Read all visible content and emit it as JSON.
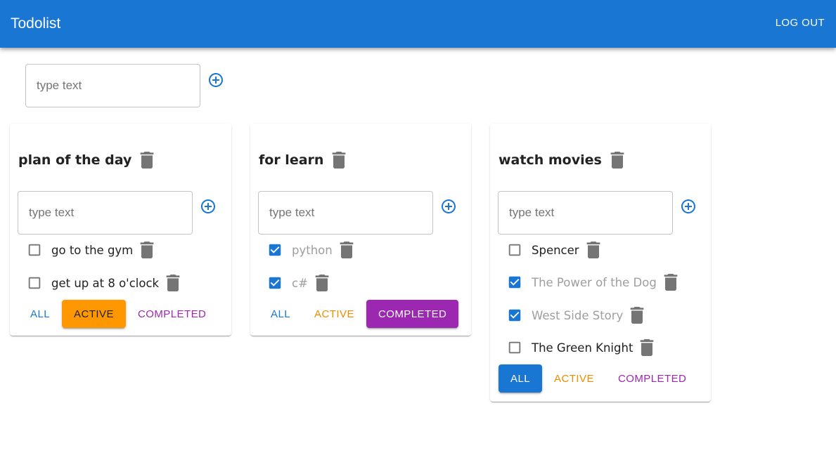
{
  "app": {
    "title": "Todolist",
    "logout_label": "LOG OUT"
  },
  "new_list": {
    "placeholder": "type text",
    "value": ""
  },
  "icons": {
    "add": "add-circle-outline-icon",
    "delete": "trash-icon",
    "checkbox": "checkbox-icon"
  },
  "colors": {
    "primary": "#1976d2",
    "active": "#ff9800",
    "completed": "#9c27b0",
    "icon_gray": "#757575"
  },
  "lists": [
    {
      "title": "plan of the day",
      "input": {
        "placeholder": "type text",
        "value": ""
      },
      "tasks": [
        {
          "text": "go to the gym",
          "done": false
        },
        {
          "text": "get up at 8 o'clock",
          "done": false
        }
      ],
      "filter": {
        "all": "ALL",
        "active": "ACTIVE",
        "completed": "COMPLETED",
        "selected": "active"
      }
    },
    {
      "title": "for learn",
      "input": {
        "placeholder": "type text",
        "value": ""
      },
      "tasks": [
        {
          "text": "python",
          "done": true
        },
        {
          "text": "c#",
          "done": true
        }
      ],
      "filter": {
        "all": "ALL",
        "active": "ACTIVE",
        "completed": "COMPLETED",
        "selected": "completed"
      }
    },
    {
      "title": "watch movies",
      "input": {
        "placeholder": "type text",
        "value": ""
      },
      "tasks": [
        {
          "text": "Spencer",
          "done": false
        },
        {
          "text": "The Power of the Dog",
          "done": true
        },
        {
          "text": "West Side Story",
          "done": true
        },
        {
          "text": "The Green Knight",
          "done": false
        }
      ],
      "filter": {
        "all": "ALL",
        "active": "ACTIVE",
        "completed": "COMPLETED",
        "selected": "all"
      }
    }
  ]
}
